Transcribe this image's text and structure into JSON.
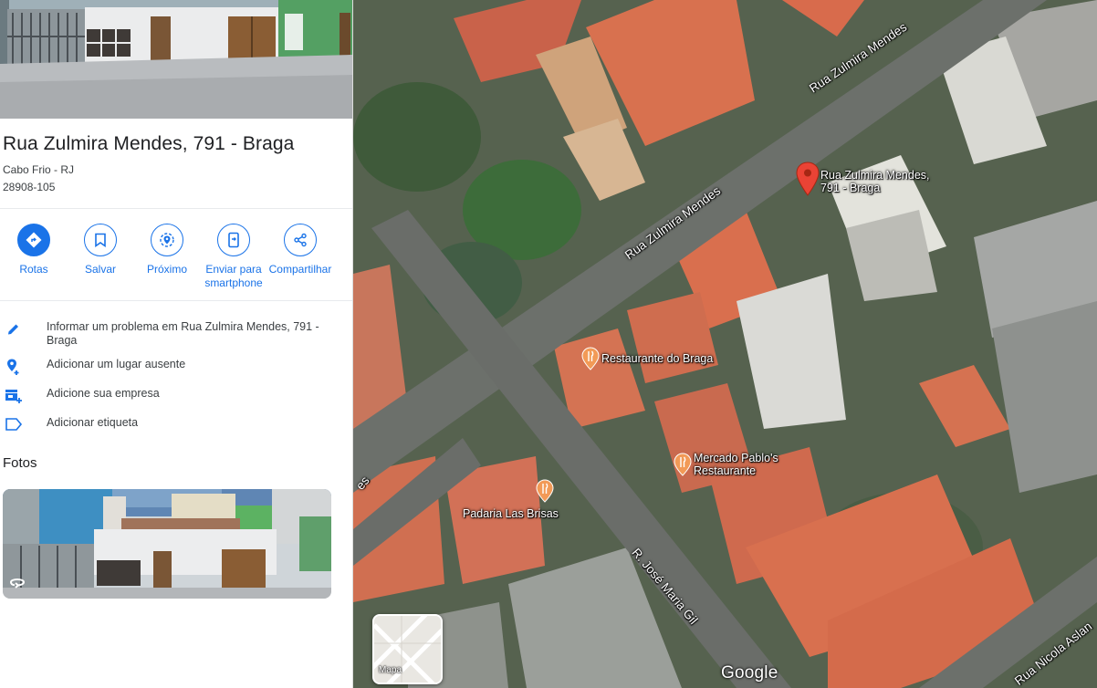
{
  "place": {
    "title": "Rua Zulmira Mendes, 791 - Braga",
    "city": "Cabo Frio - RJ",
    "zip": "28908-105"
  },
  "actions": [
    {
      "label": "Rotas",
      "icon": "directions-icon"
    },
    {
      "label": "Salvar",
      "icon": "bookmark-icon"
    },
    {
      "label": "Próximo",
      "icon": "nearby-icon"
    },
    {
      "label": "Enviar para smartphone",
      "icon": "send-to-phone-icon"
    },
    {
      "label": "Compartilhar",
      "icon": "share-icon"
    }
  ],
  "list_items": [
    {
      "text": "Informar um problema em Rua Zulmira Mendes, 791 - Braga",
      "icon": "pencil-icon"
    },
    {
      "text": "Adicionar um lugar ausente",
      "icon": "add-place-icon"
    },
    {
      "text": "Adicione sua empresa",
      "icon": "add-business-icon"
    },
    {
      "text": "Adicionar etiqueta",
      "icon": "label-icon"
    }
  ],
  "photos": {
    "heading": "Fotos"
  },
  "map": {
    "streets": [
      "Rua Zulmira Mendes",
      "Rua Zulmira Mendes",
      "R. José Maria Gil",
      "Rua Nicola Aslan",
      "es"
    ],
    "pin_label": "Rua Zulmira Mendes, 791 - Braga",
    "pois": [
      "Restaurante do Braga",
      "Mercado Pablo's Restaurante",
      "Padaria Las Brisas"
    ],
    "layer_toggle": "Mapa",
    "logo": "Google",
    "accent_color": "#1a73e8",
    "pin_color": "#ea4335",
    "poi_color": "#f29a57"
  }
}
